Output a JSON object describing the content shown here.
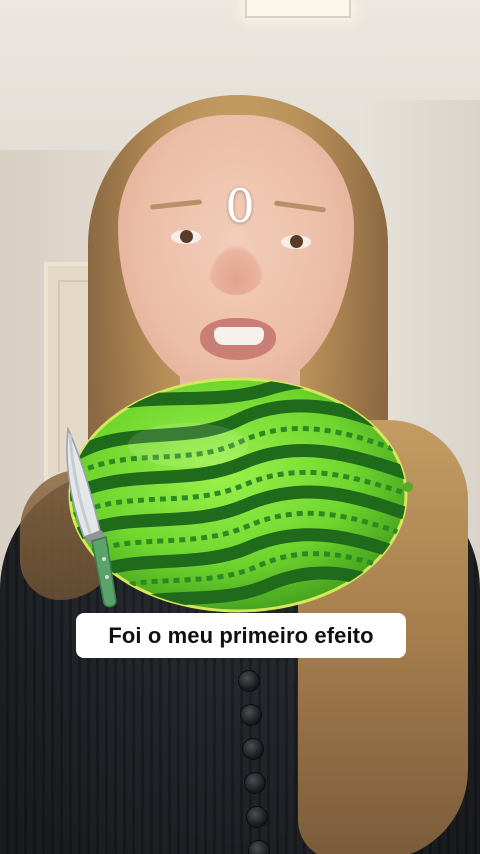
{
  "effect": {
    "counter": "0",
    "caption": "Foi o meu primeiro efeito",
    "objects": [
      "watermelon",
      "knife"
    ]
  },
  "colors": {
    "watermelon_light": "#7ee83a",
    "watermelon_dark": "#1e6a1a",
    "knife_handle": "#5aa36a",
    "caption_bg": "#ffffff",
    "caption_text": "#111111"
  }
}
